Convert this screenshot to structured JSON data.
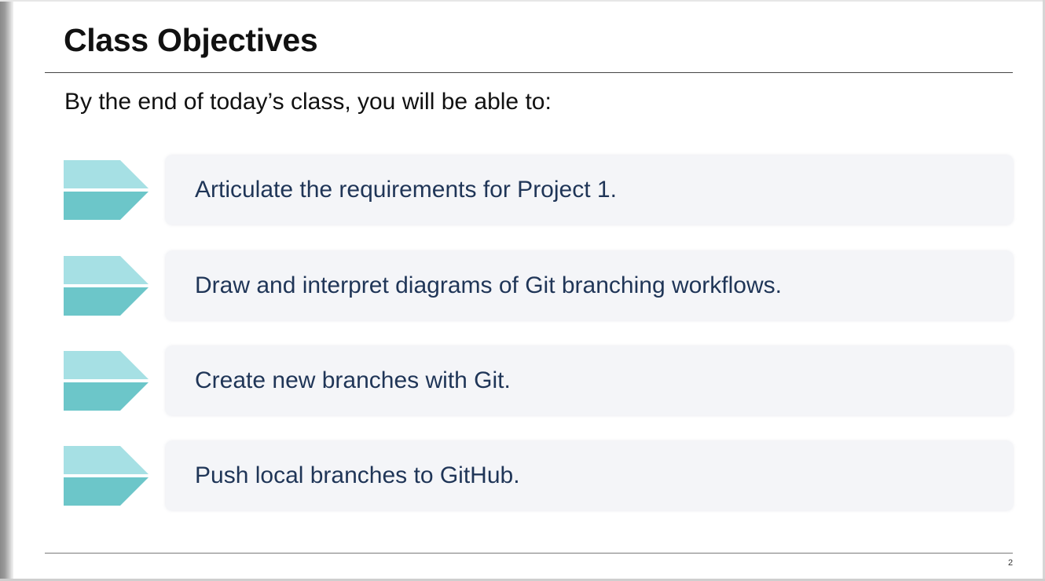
{
  "slide": {
    "title": "Class Objectives",
    "subtitle": "By the end of today’s class, you will be able to:",
    "objectives": [
      {
        "text": "Articulate the requirements for Project 1."
      },
      {
        "text": "Draw and interpret diagrams of Git branching workflows."
      },
      {
        "text": "Create new branches with Git."
      },
      {
        "text": "Push local branches to GitHub."
      }
    ],
    "page_number": "2"
  },
  "colors": {
    "chevron_top": "#a6e0e4",
    "chevron_bottom": "#6cc6c9",
    "card_background": "#f4f5f8",
    "objective_text": "#1f3557",
    "title_text": "#111111"
  },
  "icons": {
    "objective_bullet": "chevron-arrow-icon"
  }
}
